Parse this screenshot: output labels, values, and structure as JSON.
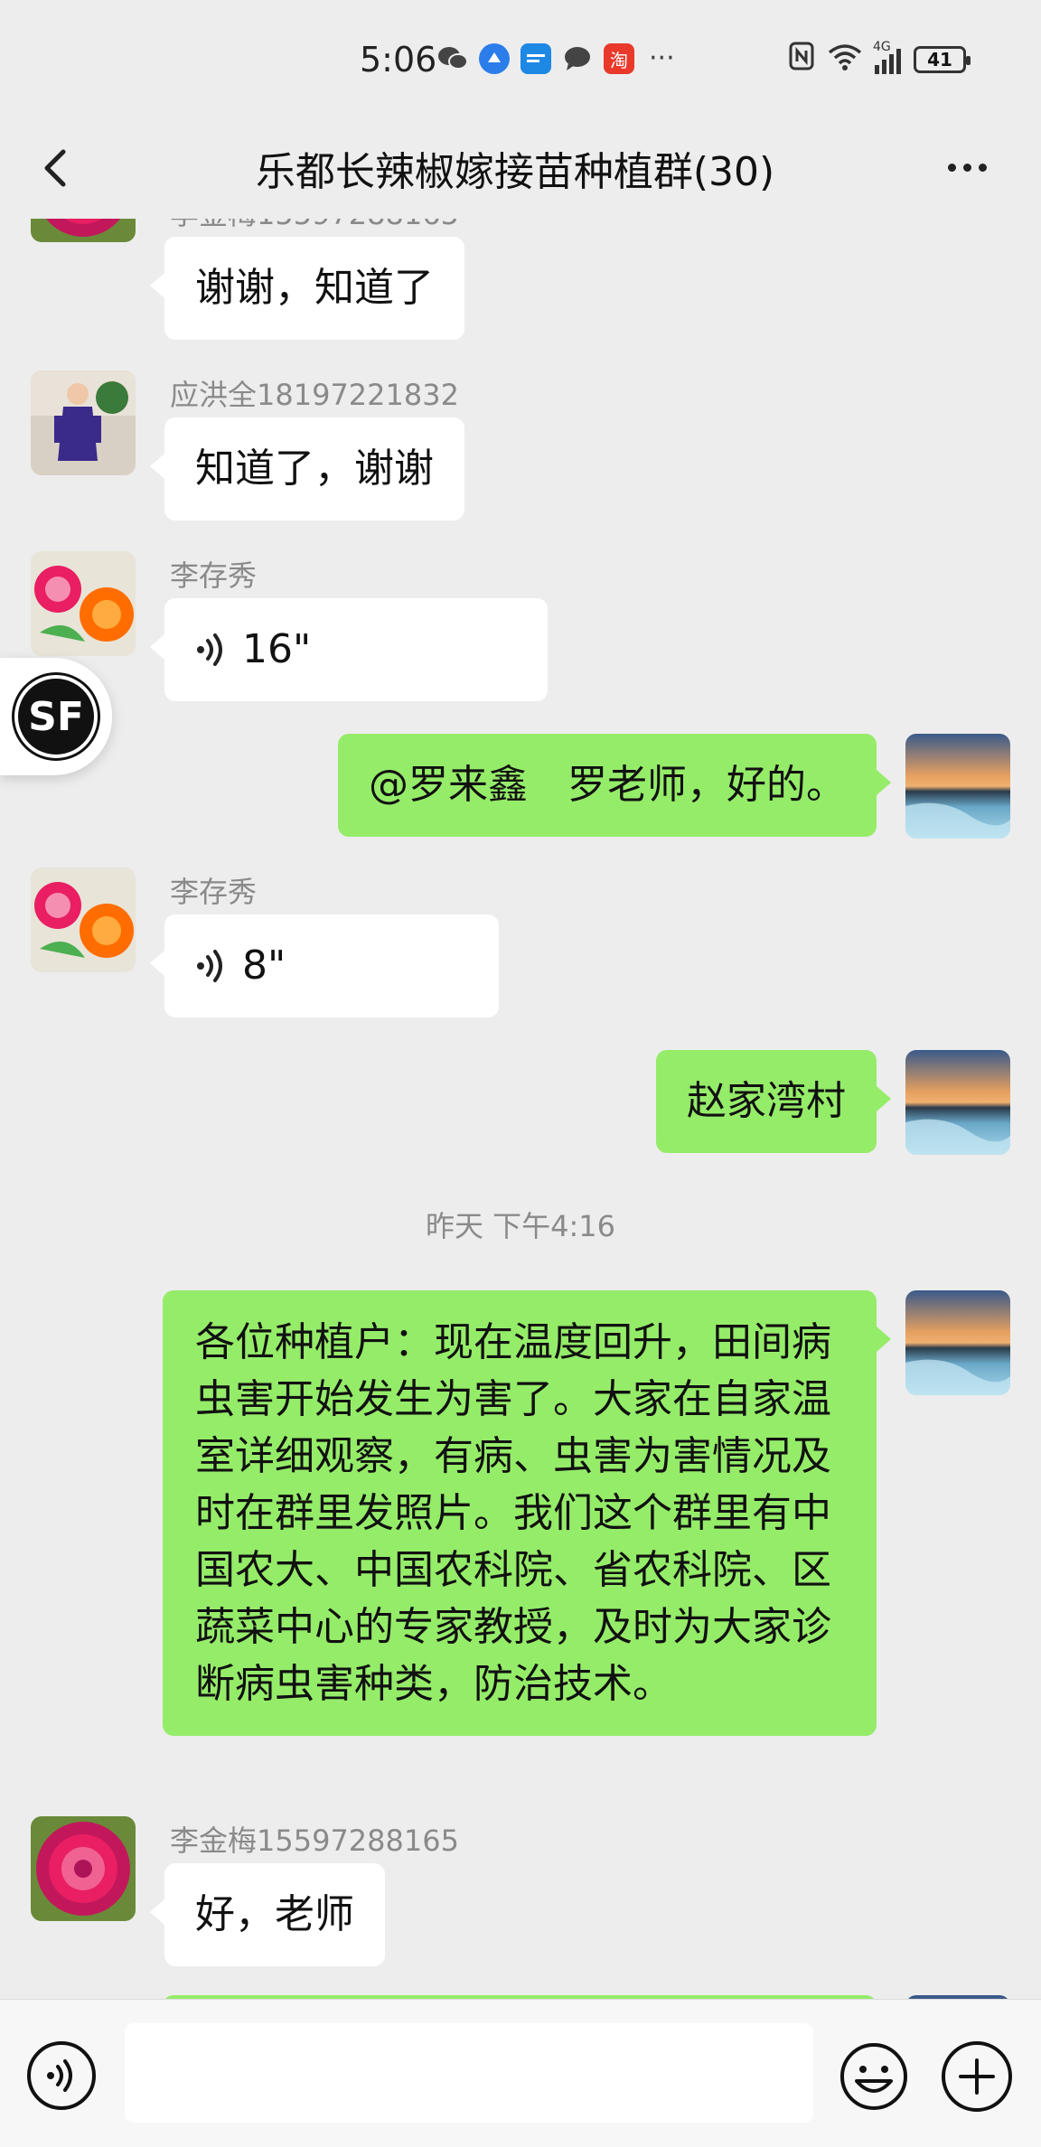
{
  "status_bar": {
    "time": "5:06",
    "apps": [
      "wechat-icon",
      "browser-icon",
      "news-app-icon",
      "message-icon",
      "taobao-icon"
    ],
    "taobao_glyph": "淘",
    "more": "···",
    "network": "4G",
    "battery": "41"
  },
  "nav": {
    "title": "乐都长辣椒嫁接苗种植群(30)"
  },
  "messages": [
    {
      "side": "in",
      "sender": "",
      "text": "谢谢，知道了",
      "avatar": "dahlia"
    },
    {
      "side": "in",
      "sender": "应洪全18197221832",
      "text": "知道了，谢谢",
      "avatar": "child"
    },
    {
      "side": "in",
      "sender": "李存秀",
      "voice": "16\"",
      "avatar": "peony"
    },
    {
      "side": "out",
      "text": "@罗来鑫　罗老师，好的。",
      "avatar": "sunset"
    },
    {
      "side": "in",
      "sender": "李存秀",
      "voice": "8\"",
      "avatar": "peony"
    },
    {
      "side": "out",
      "text": "赵家湾村",
      "avatar": "sunset"
    },
    {
      "type": "time",
      "text": "昨天 下午4:16"
    },
    {
      "side": "out",
      "text": "各位种植户：现在温度回升，田间病虫害开始发生为害了。大家在自家温室详细观察，有病、虫害为害情况及时在群里发照片。我们这个群里有中国农大、中国农科院、省农科院、区蔬菜中心的专家教授，及时为大家诊断病虫害种类，防治技术。",
      "avatar": "sunset"
    },
    {
      "side": "in",
      "sender": "李金梅15597288165",
      "text": "好，老师",
      "avatar": "dahlia"
    }
  ],
  "floating": {
    "label": "SF"
  },
  "input": {
    "placeholder": ""
  },
  "colors": {
    "background": "#ededed",
    "outgoing_bubble": "#95ec69",
    "incoming_bubble": "#ffffff"
  }
}
